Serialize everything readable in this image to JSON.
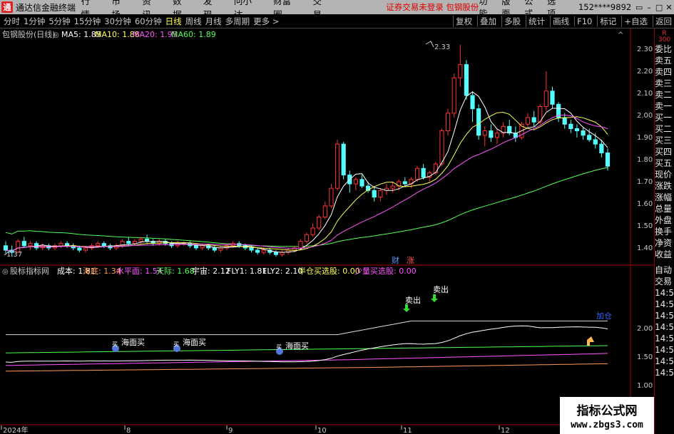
{
  "app": {
    "icon": "通",
    "title": "通达信金融终端"
  },
  "top_menu": [
    "行情",
    "市场",
    "资讯",
    "数据",
    "发现",
    "问小达",
    "财富圈",
    "交易"
  ],
  "notice": "证券交易未登录  包钢股份",
  "right_menu": [
    "功能",
    "版面",
    "公式",
    "选项"
  ],
  "account": "152****9892",
  "window_controls": [
    "▭",
    "–",
    "□",
    "✕"
  ],
  "periods": [
    "分时",
    "1分钟",
    "5分钟",
    "15分钟",
    "30分钟",
    "60分钟",
    "日线",
    "周线",
    "月线",
    "多周期",
    "更多 >"
  ],
  "active_period": "日线",
  "tool_right": [
    "复权",
    "叠加",
    "多股",
    "统计",
    "画线",
    "F10",
    "标记",
    "+自选",
    "返回"
  ],
  "main_legend": {
    "stock": "包钢股份(日线)",
    "items": [
      {
        "label": "MA5: 1.85",
        "color": "#ffffff"
      },
      {
        "label": "MA10: 1.88",
        "color": "#ffff54"
      },
      {
        "label": "MA20: 1.95",
        "color": "#ff54ff"
      },
      {
        "label": "MA60: 1.89",
        "color": "#54ff54"
      }
    ]
  },
  "price_axis": [
    "2.30",
    "2.20",
    "2.10",
    "2.00",
    "1.90",
    "1.80",
    "1.70",
    "1.60",
    "1.50",
    "1.40"
  ],
  "price_high_label": "2.33",
  "price_low_label": "1.37",
  "cai_badge": "财",
  "zhang_badge": "涨",
  "indicator_legend": {
    "name": "股标指标网",
    "items": [
      {
        "label": "成本: 1.81",
        "color": "#ffffff"
      },
      {
        "label": "海底: 1.34",
        "color": "#ff9955"
      },
      {
        "label": "水平面: 1.54",
        "color": "#ff54ff"
      },
      {
        "label": "天际: 1.68",
        "color": "#54ff54"
      },
      {
        "label": "宇宙: 2.12",
        "color": "#ffffff"
      },
      {
        "label": "FLY1: 1.81",
        "color": "#ffffff"
      },
      {
        "label": "FLY2: 2.10",
        "color": "#ffffff"
      },
      {
        "label": "半仓买选股: 0.00",
        "color": "#ffff54"
      },
      {
        "label": "少量买选股: 0.00",
        "color": "#ff54ff"
      }
    ]
  },
  "indicator_axis": [
    "2.00",
    "1.50",
    "1.00"
  ],
  "markers": {
    "sell": "卖出",
    "haimian": "海面买",
    "haimian_tag": "买",
    "jiacang": "加仓"
  },
  "x_axis": {
    "labels": [
      "2024年",
      "8",
      "9",
      "10",
      "11",
      "12"
    ]
  },
  "side_panel": {
    "icon_line1": "R",
    "icon_line2": "300",
    "items": [
      "委比",
      "卖五",
      "卖四",
      "卖三",
      "卖二",
      "卖一",
      "买一",
      "买二",
      "买三",
      "买四",
      "买五",
      "现价",
      "涨跌",
      "涨幅",
      "总量",
      "外盘",
      "换手",
      "净资",
      "收益"
    ],
    "items2": [
      "自动",
      "交易"
    ],
    "times": [
      "14:56",
      "14:56",
      "14:56",
      "14:56",
      "14:56",
      "14:56",
      "14:56",
      "14:56"
    ]
  },
  "watermark": {
    "line1": "指标公式网",
    "line2": "www.zbgs3.com"
  },
  "chart_data": {
    "type": "candlestick",
    "price_range": [
      1.35,
      2.35
    ],
    "candles": [
      [
        1.42,
        1.44,
        1.38,
        1.4
      ],
      [
        1.4,
        1.42,
        1.37,
        1.39
      ],
      [
        1.39,
        1.45,
        1.39,
        1.44
      ],
      [
        1.44,
        1.46,
        1.41,
        1.42
      ],
      [
        1.42,
        1.44,
        1.4,
        1.43
      ],
      [
        1.43,
        1.44,
        1.4,
        1.41
      ],
      [
        1.41,
        1.43,
        1.4,
        1.42
      ],
      [
        1.42,
        1.43,
        1.4,
        1.41
      ],
      [
        1.41,
        1.43,
        1.4,
        1.42
      ],
      [
        1.42,
        1.44,
        1.41,
        1.43
      ],
      [
        1.43,
        1.44,
        1.41,
        1.42
      ],
      [
        1.42,
        1.43,
        1.4,
        1.41
      ],
      [
        1.41,
        1.42,
        1.39,
        1.4
      ],
      [
        1.4,
        1.42,
        1.39,
        1.41
      ],
      [
        1.41,
        1.43,
        1.4,
        1.42
      ],
      [
        1.42,
        1.44,
        1.41,
        1.43
      ],
      [
        1.43,
        1.44,
        1.41,
        1.42
      ],
      [
        1.42,
        1.43,
        1.4,
        1.41
      ],
      [
        1.41,
        1.43,
        1.4,
        1.42
      ],
      [
        1.42,
        1.45,
        1.41,
        1.44
      ],
      [
        1.44,
        1.46,
        1.42,
        1.43
      ],
      [
        1.43,
        1.45,
        1.42,
        1.44
      ],
      [
        1.44,
        1.46,
        1.43,
        1.45
      ],
      [
        1.45,
        1.47,
        1.43,
        1.44
      ],
      [
        1.44,
        1.45,
        1.42,
        1.43
      ],
      [
        1.43,
        1.45,
        1.42,
        1.44
      ],
      [
        1.44,
        1.45,
        1.42,
        1.43
      ],
      [
        1.43,
        1.44,
        1.41,
        1.42
      ],
      [
        1.42,
        1.44,
        1.41,
        1.43
      ],
      [
        1.43,
        1.44,
        1.42,
        1.43
      ],
      [
        1.43,
        1.44,
        1.41,
        1.42
      ],
      [
        1.42,
        1.43,
        1.4,
        1.41
      ],
      [
        1.41,
        1.43,
        1.4,
        1.42
      ],
      [
        1.42,
        1.43,
        1.4,
        1.41
      ],
      [
        1.41,
        1.42,
        1.39,
        1.4
      ],
      [
        1.4,
        1.42,
        1.39,
        1.41
      ],
      [
        1.41,
        1.43,
        1.4,
        1.42
      ],
      [
        1.42,
        1.44,
        1.41,
        1.43
      ],
      [
        1.43,
        1.44,
        1.41,
        1.42
      ],
      [
        1.42,
        1.43,
        1.4,
        1.41
      ],
      [
        1.41,
        1.42,
        1.39,
        1.4
      ],
      [
        1.4,
        1.41,
        1.38,
        1.39
      ],
      [
        1.39,
        1.41,
        1.38,
        1.4
      ],
      [
        1.4,
        1.41,
        1.38,
        1.39
      ],
      [
        1.39,
        1.4,
        1.37,
        1.38
      ],
      [
        1.38,
        1.4,
        1.37,
        1.39
      ],
      [
        1.39,
        1.41,
        1.38,
        1.4
      ],
      [
        1.4,
        1.42,
        1.39,
        1.41
      ],
      [
        1.41,
        1.45,
        1.4,
        1.44
      ],
      [
        1.44,
        1.48,
        1.43,
        1.47
      ],
      [
        1.47,
        1.52,
        1.46,
        1.5
      ],
      [
        1.5,
        1.56,
        1.49,
        1.55
      ],
      [
        1.55,
        1.62,
        1.54,
        1.6
      ],
      [
        1.6,
        1.7,
        1.59,
        1.68
      ],
      [
        1.68,
        1.9,
        1.67,
        1.88
      ],
      [
        1.88,
        1.89,
        1.72,
        1.74
      ],
      [
        1.74,
        1.76,
        1.66,
        1.7
      ],
      [
        1.7,
        1.73,
        1.67,
        1.72
      ],
      [
        1.72,
        1.74,
        1.68,
        1.69
      ],
      [
        1.69,
        1.71,
        1.66,
        1.67
      ],
      [
        1.67,
        1.69,
        1.62,
        1.64
      ],
      [
        1.64,
        1.68,
        1.62,
        1.67
      ],
      [
        1.67,
        1.7,
        1.65,
        1.68
      ],
      [
        1.68,
        1.71,
        1.66,
        1.69
      ],
      [
        1.69,
        1.72,
        1.67,
        1.71
      ],
      [
        1.71,
        1.73,
        1.69,
        1.7
      ],
      [
        1.7,
        1.73,
        1.68,
        1.72
      ],
      [
        1.72,
        1.78,
        1.71,
        1.77
      ],
      [
        1.77,
        1.79,
        1.72,
        1.73
      ],
      [
        1.73,
        1.76,
        1.71,
        1.75
      ],
      [
        1.75,
        1.8,
        1.74,
        1.79
      ],
      [
        1.79,
        1.95,
        1.78,
        1.94
      ],
      [
        1.94,
        2.04,
        1.92,
        2.02
      ],
      [
        2.02,
        2.2,
        2.0,
        2.18
      ],
      [
        2.18,
        2.33,
        2.14,
        2.24
      ],
      [
        2.24,
        2.26,
        2.08,
        2.1
      ],
      [
        2.1,
        2.12,
        1.98,
        2.04
      ],
      [
        2.04,
        2.06,
        1.9,
        1.92
      ],
      [
        1.92,
        1.96,
        1.87,
        1.94
      ],
      [
        1.94,
        1.97,
        1.89,
        1.91
      ],
      [
        1.91,
        1.95,
        1.88,
        1.93
      ],
      [
        1.93,
        1.98,
        1.91,
        1.96
      ],
      [
        1.96,
        1.99,
        1.92,
        1.93
      ],
      [
        1.93,
        1.96,
        1.89,
        1.91
      ],
      [
        1.91,
        1.98,
        1.9,
        1.97
      ],
      [
        1.97,
        2.02,
        1.95,
        2.0
      ],
      [
        2.0,
        2.03,
        1.96,
        1.98
      ],
      [
        1.98,
        2.06,
        1.97,
        2.05
      ],
      [
        2.05,
        2.21,
        2.03,
        2.12
      ],
      [
        2.12,
        2.14,
        2.04,
        2.06
      ],
      [
        2.06,
        2.07,
        1.98,
        2.0
      ],
      [
        2.0,
        2.02,
        1.95,
        1.97
      ],
      [
        1.97,
        1.99,
        1.93,
        1.95
      ],
      [
        1.95,
        1.97,
        1.91,
        1.94
      ],
      [
        1.94,
        1.96,
        1.9,
        1.92
      ],
      [
        1.92,
        1.95,
        1.89,
        1.9
      ],
      [
        1.9,
        1.93,
        1.86,
        1.88
      ],
      [
        1.88,
        1.9,
        1.82,
        1.84
      ],
      [
        1.84,
        1.86,
        1.76,
        1.78
      ]
    ],
    "indicator_range": [
      0.8,
      2.35
    ]
  }
}
